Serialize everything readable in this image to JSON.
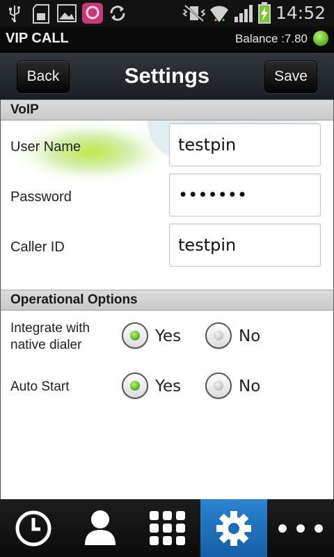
{
  "status_bar": {
    "time": "14:52",
    "icons": [
      "usb-icon",
      "sd-card-icon",
      "gallery-icon",
      "app-notification-icon",
      "sync-icon",
      "vibrate-icon",
      "wifi-icon",
      "signal-icon",
      "battery-charging-icon"
    ]
  },
  "title_bar": {
    "app_name": "VIP CALL",
    "balance": "Balance :7.80",
    "status_color": "#5cb81c"
  },
  "nav_bar": {
    "back_label": "Back",
    "title": "Settings",
    "save_label": "Save"
  },
  "voip": {
    "header": "VoIP",
    "fields": [
      {
        "label": "User Name",
        "value": "testpin"
      },
      {
        "label": "Password",
        "value": "•••••••"
      },
      {
        "label": "Caller ID",
        "value": "testpin"
      }
    ]
  },
  "options": {
    "header": "Operational Options",
    "rows": [
      {
        "label_line1": "Integrate with",
        "label_line2": "native dialer",
        "yes": "Yes",
        "no": "No",
        "selected": "Yes"
      },
      {
        "label": "Auto Start",
        "yes": "Yes",
        "no": "No",
        "selected": "Yes"
      }
    ]
  },
  "tab_bar": {
    "tabs": [
      {
        "icon": "clock-icon",
        "active": false
      },
      {
        "icon": "contact-icon",
        "active": false
      },
      {
        "icon": "dialpad-icon",
        "active": false
      },
      {
        "icon": "gear-icon",
        "active": true
      },
      {
        "icon": "more-icon",
        "active": false
      }
    ],
    "accent": "#1e6fbf"
  }
}
